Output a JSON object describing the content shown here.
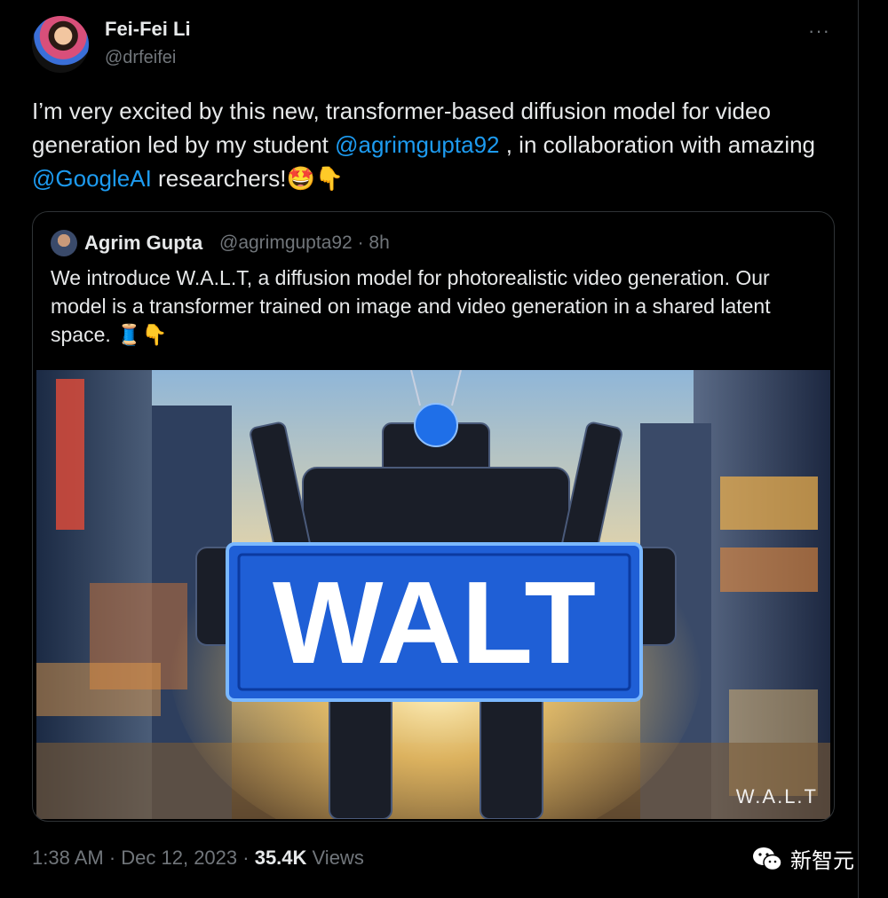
{
  "tweet": {
    "author_name": "Fei-Fei Li",
    "author_handle": "@drfeifei",
    "more_glyph": "···",
    "text_parts": [
      "I’m very excited by this new, transformer-based diffusion model for video generation led by my student ",
      "@agrimgupta92",
      " , in collaboration with amazing ",
      "@GoogleAI",
      " researchers!🤩👇"
    ],
    "time": "1:38 AM · Dec 12, 2023 · ",
    "views_count": "35.4K",
    "views_label": " Views"
  },
  "quoted": {
    "author_name": "Agrim Gupta",
    "meta": "@agrimgupta92 · 8h",
    "text": "We introduce W.A.L.T, a diffusion model for photorealistic video generation. Our model is a transformer trained on image and video generation in a shared latent space. 🧵👇",
    "media_sign_text": "WALT",
    "media_watermark": "W.A.L.T"
  },
  "corner_watermark": {
    "label": "新智元",
    "icon": "wechat-icon"
  },
  "colors": {
    "background": "#000000",
    "text": "#e7e9ea",
    "muted": "#71767b",
    "link": "#1d9bf0",
    "border": "#2f3336",
    "sign_blue": "#1f5fd6"
  }
}
